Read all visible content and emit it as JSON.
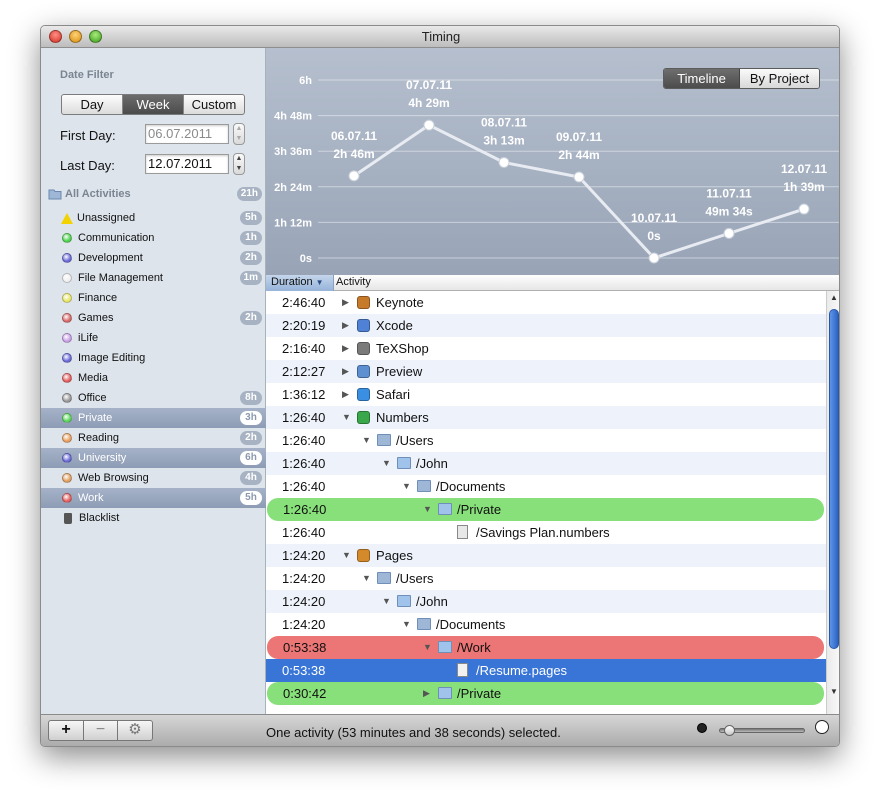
{
  "window": {
    "title": "Timing"
  },
  "sidebar": {
    "date_filter_label": "Date Filter",
    "range_tabs": [
      {
        "label": "Day",
        "selected": false
      },
      {
        "label": "Week",
        "selected": true
      },
      {
        "label": "Custom",
        "selected": false
      }
    ],
    "first_day_label": "First Day:",
    "first_day_value": "06.07.2011",
    "last_day_label": "Last Day:",
    "last_day_value": "12.07.2011",
    "all_activities": {
      "label": "All Activities",
      "badge": "21h"
    },
    "activities": [
      {
        "label": "Unassigned",
        "badge": "5h",
        "color": "#f2d200",
        "icon": "warning-icon",
        "highlighted": false
      },
      {
        "label": "Communication",
        "badge": "1h",
        "color": "#4fd24f",
        "icon": "dot",
        "highlighted": false
      },
      {
        "label": "Development",
        "badge": "2h",
        "color": "#6b6bd8",
        "icon": "dot",
        "highlighted": false
      },
      {
        "label": "File Management",
        "badge": "1m",
        "color": "#f0f0f0",
        "icon": "dot",
        "highlighted": false
      },
      {
        "label": "Finance",
        "badge": "",
        "color": "#e8e66a",
        "icon": "dot",
        "highlighted": false
      },
      {
        "label": "Games",
        "badge": "2h",
        "color": "#d86a6a",
        "icon": "dot",
        "highlighted": false
      },
      {
        "label": "iLife",
        "badge": "",
        "color": "#c9a0e6",
        "icon": "dot",
        "highlighted": false
      },
      {
        "label": "Image Editing",
        "badge": "",
        "color": "#6b6bd8",
        "icon": "dot",
        "highlighted": false
      },
      {
        "label": "Media",
        "badge": "",
        "color": "#e26060",
        "icon": "dot",
        "highlighted": false
      },
      {
        "label": "Office",
        "badge": "8h",
        "color": "#9a9a9a",
        "icon": "dot",
        "highlighted": false
      },
      {
        "label": "Private",
        "badge": "3h",
        "color": "#5bd85b",
        "icon": "dot",
        "highlighted": true
      },
      {
        "label": "Reading",
        "badge": "2h",
        "color": "#e8a060",
        "icon": "dot",
        "highlighted": false
      },
      {
        "label": "University",
        "badge": "6h",
        "color": "#6b6bd8",
        "icon": "dot",
        "highlighted": true
      },
      {
        "label": "Web Browsing",
        "badge": "4h",
        "color": "#e0a060",
        "icon": "dot",
        "highlighted": false
      },
      {
        "label": "Work",
        "badge": "5h",
        "color": "#e26060",
        "icon": "dot",
        "highlighted": true
      },
      {
        "label": "Blacklist",
        "badge": "",
        "color": "#555555",
        "icon": "trash-icon",
        "highlighted": false
      }
    ]
  },
  "view_tabs": [
    {
      "label": "Timeline",
      "selected": true
    },
    {
      "label": "By Project",
      "selected": false
    }
  ],
  "chart_data": {
    "type": "line",
    "y_tick_labels": [
      "0s",
      "1h 12m",
      "2h 24m",
      "3h 36m",
      "4h 48m",
      "6h"
    ],
    "ylim_hours": [
      0,
      6
    ],
    "grid": true,
    "points": [
      {
        "date": "06.07.11",
        "label": "2h 46m",
        "hours": 2.77
      },
      {
        "date": "07.07.11",
        "label": "4h 29m",
        "hours": 4.48
      },
      {
        "date": "08.07.11",
        "label": "3h 13m",
        "hours": 3.22
      },
      {
        "date": "09.07.11",
        "label": "2h 44m",
        "hours": 2.73
      },
      {
        "date": "10.07.11",
        "label": "0s",
        "hours": 0
      },
      {
        "date": "11.07.11",
        "label": "49m 34s",
        "hours": 0.83
      },
      {
        "date": "12.07.11",
        "label": "1h 39m",
        "hours": 1.65
      }
    ]
  },
  "table": {
    "col_duration": "Duration",
    "col_activity": "Activity",
    "rows": [
      {
        "duration": "2:46:40",
        "name": "Keynote",
        "level": 0,
        "expanded": false,
        "icon": "keynote-icon",
        "style": ""
      },
      {
        "duration": "2:20:19",
        "name": "Xcode",
        "level": 0,
        "expanded": false,
        "icon": "xcode-icon",
        "style": "alt"
      },
      {
        "duration": "2:16:40",
        "name": "TeXShop",
        "level": 0,
        "expanded": false,
        "icon": "texshop-icon",
        "style": ""
      },
      {
        "duration": "2:12:27",
        "name": "Preview",
        "level": 0,
        "expanded": false,
        "icon": "preview-icon",
        "style": "alt"
      },
      {
        "duration": "1:36:12",
        "name": "Safari",
        "level": 0,
        "expanded": false,
        "icon": "safari-icon",
        "style": ""
      },
      {
        "duration": "1:26:40",
        "name": "Numbers",
        "level": 0,
        "expanded": true,
        "icon": "numbers-icon",
        "style": "alt"
      },
      {
        "duration": "1:26:40",
        "name": "/Users",
        "level": 1,
        "expanded": true,
        "icon": "users-folder-icon",
        "style": ""
      },
      {
        "duration": "1:26:40",
        "name": "/John",
        "level": 2,
        "expanded": true,
        "icon": "folder-icon",
        "style": "alt"
      },
      {
        "duration": "1:26:40",
        "name": "/Documents",
        "level": 3,
        "expanded": true,
        "icon": "documents-folder-icon",
        "style": ""
      },
      {
        "duration": "1:26:40",
        "name": "/Private",
        "level": 4,
        "expanded": true,
        "icon": "folder-icon",
        "style": "green"
      },
      {
        "duration": "1:26:40",
        "name": "/Savings Plan.numbers",
        "level": 5,
        "expanded": null,
        "icon": "numbers-file-icon",
        "style": ""
      },
      {
        "duration": "1:24:20",
        "name": "Pages",
        "level": 0,
        "expanded": true,
        "icon": "pages-icon",
        "style": "alt"
      },
      {
        "duration": "1:24:20",
        "name": "/Users",
        "level": 1,
        "expanded": true,
        "icon": "users-folder-icon",
        "style": ""
      },
      {
        "duration": "1:24:20",
        "name": "/John",
        "level": 2,
        "expanded": true,
        "icon": "folder-icon",
        "style": "alt"
      },
      {
        "duration": "1:24:20",
        "name": "/Documents",
        "level": 3,
        "expanded": true,
        "icon": "documents-folder-icon",
        "style": ""
      },
      {
        "duration": "0:53:38",
        "name": "/Work",
        "level": 4,
        "expanded": true,
        "icon": "folder-icon",
        "style": "red"
      },
      {
        "duration": "0:53:38",
        "name": "/Resume.pages",
        "level": 5,
        "expanded": null,
        "icon": "pages-file-icon",
        "style": "sel"
      },
      {
        "duration": "0:30:42",
        "name": "/Private",
        "level": 4,
        "expanded": false,
        "icon": "folder-icon",
        "style": "green"
      }
    ]
  },
  "bottom_bar": {
    "add_label": "+",
    "remove_label": "−",
    "status_text": "One activity (53 minutes and 38 seconds) selected.",
    "zoom_level": 0.05
  },
  "colors": {
    "selection": "#3875d7",
    "private_row": "#88e07a",
    "work_row": "#ec7575",
    "sidebar_bg": "#dde4ec",
    "chart_bg": "#a8b3c4"
  }
}
